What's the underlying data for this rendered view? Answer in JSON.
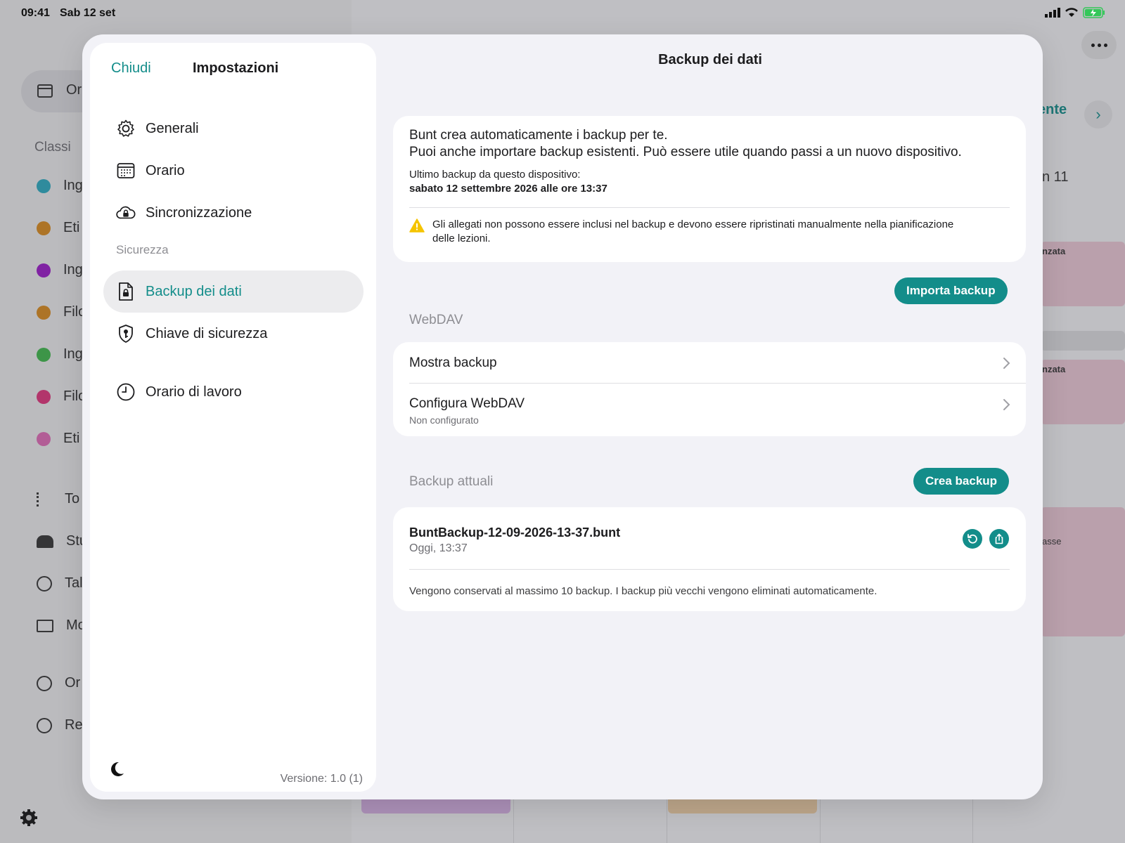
{
  "status_bar": {
    "time": "09:41",
    "date": "Sab 12 set"
  },
  "background": {
    "sidebar_items": [
      "Or",
      "Ing",
      "Eti",
      "Ing",
      "Filo",
      "Ing",
      "Filo",
      "Eti",
      "To",
      "Stu",
      "Tal",
      "Mo",
      "Or",
      "Re"
    ],
    "section_label": "Classi",
    "right_texts": [
      "ente",
      "n 11",
      "nzata",
      "nzata",
      "asse"
    ],
    "dot_colors": [
      "#2aaabf",
      "#d9891c",
      "#9a18c8",
      "#d9891c",
      "#3db84a",
      "#e0337a",
      "#e06ab6"
    ]
  },
  "settings": {
    "close_label": "Chiudi",
    "title": "Impostazioni",
    "nav": [
      {
        "label": "Generali",
        "icon": "gear-icon"
      },
      {
        "label": "Orario",
        "icon": "calendar-icon"
      },
      {
        "label": "Sincronizzazione",
        "icon": "cloud-lock-icon"
      }
    ],
    "security_section": "Sicurezza",
    "security_nav": [
      {
        "label": "Backup dei dati",
        "icon": "doc-lock-icon",
        "active": true
      },
      {
        "label": "Chiave di sicurezza",
        "icon": "shield-key-icon"
      }
    ],
    "work_nav": {
      "label": "Orario di lavoro",
      "icon": "clock-icon"
    },
    "version": "Versione: 1.0 (1)"
  },
  "detail": {
    "title": "Backup dei dati",
    "intro_line1": "Bunt crea automaticamente i backup per te.",
    "intro_line2": "Puoi anche importare backup esistenti. Può essere utile quando passi a un nuovo dispositivo.",
    "last_backup_label": "Ultimo backup da questo dispositivo:",
    "last_backup_value": "sabato 12 settembre 2026 alle ore 13:37",
    "warning": "Gli allegati non possono essere inclusi nel backup e devono essere ripristinati manualmente nella pianificazione delle lezioni.",
    "import_button": "Importa backup",
    "webdav_section": "WebDAV",
    "show_backup": "Mostra backup",
    "configure_webdav": "Configura WebDAV",
    "configure_status": "Non configurato",
    "current_section": "Backup attuali",
    "create_button": "Crea backup",
    "file_name": "BuntBackup-12-09-2026-13-37.bunt",
    "file_date": "Oggi, 13:37",
    "retention_note": "Vengono conservati al massimo 10 backup. I backup più vecchi vengono eliminati automaticamente."
  },
  "colors": {
    "accent": "#138d8a",
    "warning": "#f5c400"
  }
}
